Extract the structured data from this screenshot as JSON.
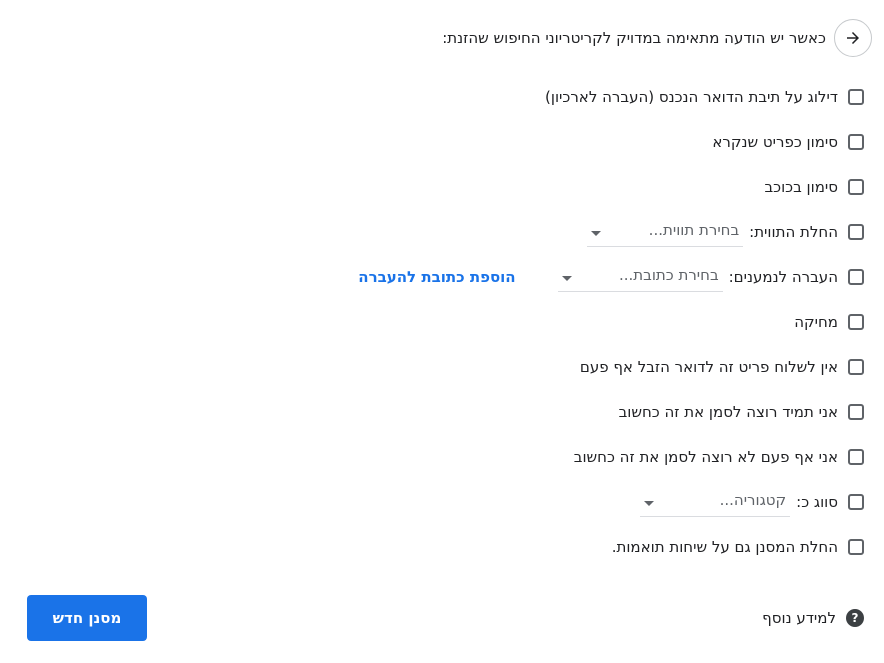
{
  "header": {
    "back_icon": "arrow-right-icon",
    "text": "כאשר יש הודעה מתאימה במדויק לקריטריוני החיפוש שהזנת:"
  },
  "options": [
    {
      "label": "דילוג על תיבת הדואר הנכנס (העברה לארכיון)"
    },
    {
      "label": "סימון כפריט שנקרא"
    },
    {
      "label": "סימון בכוכב"
    },
    {
      "label": "החלת התווית:",
      "select": "בחירת תווית..."
    },
    {
      "label": "העברה לנמענים:",
      "select": "בחירת כתובת...",
      "link": "הוספת כתובת להעברה"
    },
    {
      "label": "מחיקה"
    },
    {
      "label": "אין לשלוח פריט זה לדואר הזבל אף פעם"
    },
    {
      "label": "אני תמיד רוצה לסמן את זה כחשוב"
    },
    {
      "label": "אני אף פעם לא רוצה לסמן את זה כחשוב"
    },
    {
      "label": "סווג כ:",
      "select": "קטגוריה..."
    },
    {
      "label": "החלת המסנן גם על שיחות תואמות."
    }
  ],
  "footer": {
    "help_icon": "question-circle-icon",
    "help_text": "למידע נוסף",
    "create_button": "מסנן חדש"
  },
  "colors": {
    "accent": "#1a73e8",
    "text": "#202124",
    "muted": "#5f6368"
  }
}
